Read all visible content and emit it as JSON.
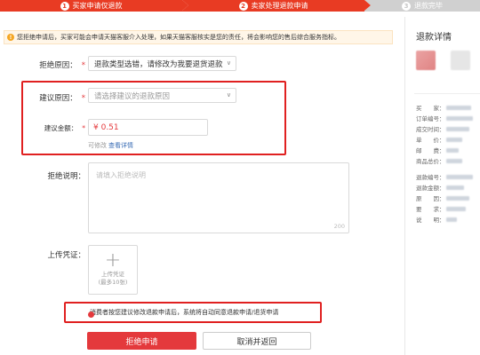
{
  "steps": [
    {
      "num": "1",
      "label": "买家申请仅退款"
    },
    {
      "num": "2",
      "label": "卖家处理退款申请"
    },
    {
      "num": "3",
      "label": "退款完毕"
    }
  ],
  "notice": {
    "icon": "!",
    "text": "您拒绝申请后，买家可能会申请天猫客服介入处理，如果天猫客服核实是您的责任，将会影响您的售后综合服务指标。"
  },
  "form": {
    "reject_reason_label": "拒绝原因：",
    "reject_reason_value": "退款类型选错，请修改为我要退货退款",
    "suggest_reason_label": "建议原因：",
    "suggest_reason_placeholder": "请选择建议的退款原因",
    "suggest_amount_label": "建议金额：",
    "suggest_amount_value": "¥ 0.51",
    "edit_hint": "可修改",
    "edit_hint_link": "查看详情",
    "reject_desc_label": "拒绝说明：",
    "reject_desc_placeholder": "请填入拒绝说明",
    "reject_desc_counter": "200",
    "upload_label": "上传凭证：",
    "upload_text": "上传凭证",
    "upload_limit": "(最多10张)",
    "required_mark": "*"
  },
  "consumer_note": "消费者按您建议修改退款申请后，系统将自动同意退款申请/退货申请",
  "buttons": {
    "reject": "拒绝申请",
    "cancel": "取消并返回"
  },
  "detail_panel": {
    "title": "退款详情",
    "rows": [
      "买　　家：",
      "订单编号：",
      "成交时间：",
      "单　　价：",
      "邮　　费：",
      "商品总价：",
      "退款编号：",
      "退款金额：",
      "原　　因：",
      "要　　求：",
      "说　　明："
    ]
  },
  "colors": {
    "accent": "#e4393c",
    "step_active": "#e83b23",
    "step_inactive": "#d0d0d0",
    "highlight": "#e02020"
  }
}
